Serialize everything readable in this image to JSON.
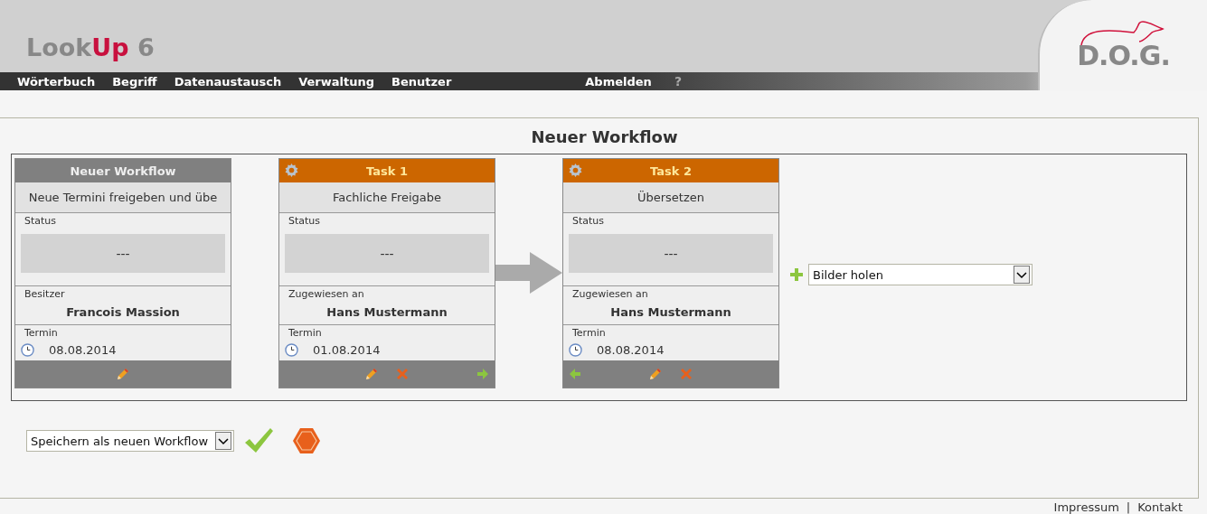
{
  "header": {
    "logo": [
      {
        "text": "Look",
        "accent": false
      },
      {
        "text": "Up",
        "accent": true
      },
      {
        "text": " 6",
        "accent": false
      }
    ],
    "brand": "D.O.G."
  },
  "nav": {
    "items": [
      "Wörterbuch",
      "Begriff",
      "Datenaustausch",
      "Verwaltung",
      "Benutzer"
    ],
    "logout": "Abmelden",
    "help": "?"
  },
  "page": {
    "title": "Neuer Workflow"
  },
  "cards": [
    {
      "kind": "start",
      "title": "Neuer Workflow",
      "name": "Neue Termini freigeben und übe",
      "status_label": "Status",
      "status": "---",
      "person_label": "Besitzer",
      "person": "Francois Massion",
      "date_label": "Termin",
      "date": "08.08.2014",
      "arrow_before": false,
      "actions": [
        {
          "kind": "edit"
        }
      ]
    },
    {
      "kind": "task",
      "title": "Task 1",
      "name": "Fachliche Freigabe",
      "status_label": "Status",
      "status": "---",
      "person_label": "Zugewiesen an",
      "person": "Hans Mustermann",
      "date_label": "Termin",
      "date": "01.08.2014",
      "arrow_before": false,
      "actions": [
        {
          "kind": "edit"
        },
        {
          "kind": "delete"
        },
        {
          "kind": "next"
        }
      ]
    },
    {
      "kind": "task",
      "title": "Task 2",
      "name": "Übersetzen",
      "status_label": "Status",
      "status": "---",
      "person_label": "Zugewiesen an",
      "person": "Hans Mustermann",
      "date_label": "Termin",
      "date": "08.08.2014",
      "arrow_before": true,
      "actions": [
        {
          "kind": "back"
        },
        {
          "kind": "edit"
        },
        {
          "kind": "delete"
        }
      ]
    }
  ],
  "add_task": {
    "value": "Bilder holen"
  },
  "save": {
    "value": "Speichern als neuen Workflow"
  },
  "footer": {
    "links": [
      "Impressum",
      "Kontakt"
    ],
    "separator": "|"
  }
}
